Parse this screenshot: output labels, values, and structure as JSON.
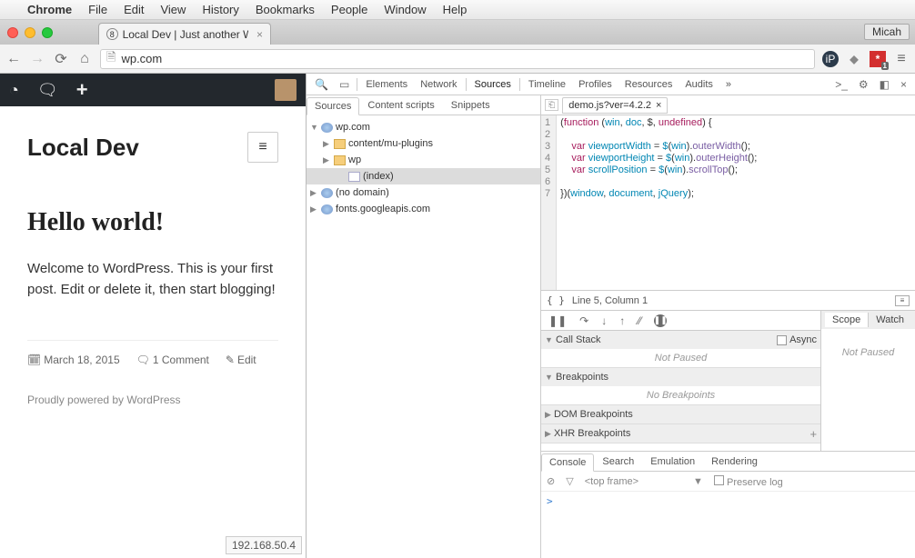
{
  "menubar": {
    "app": "Chrome",
    "items": [
      "File",
      "Edit",
      "View",
      "History",
      "Bookmarks",
      "People",
      "Window",
      "Help"
    ]
  },
  "browser": {
    "tab_title": "Local Dev | Just another W",
    "tab_favicon_text": "8",
    "user_pill": "Micah",
    "url": "wp.com"
  },
  "wordpress": {
    "site_title": "Local Dev",
    "post_title": "Hello world!",
    "post_body": "Welcome to WordPress. This is your first post. Edit or delete it, then start blogging!",
    "post_date": "March 18, 2015",
    "comments": "1 Comment",
    "edit_label": "Edit",
    "footer": "Proudly powered by WordPress",
    "ip": "192.168.50.4"
  },
  "devtools": {
    "main_tabs": [
      "Elements",
      "Network",
      "Sources",
      "Timeline",
      "Profiles",
      "Resources",
      "Audits"
    ],
    "main_overflow": "»",
    "active_main_tab": "Sources",
    "sources_subtabs": [
      "Sources",
      "Content scripts",
      "Snippets"
    ],
    "active_sources_subtab": "Sources",
    "tree": {
      "root": "wp.com",
      "children": [
        {
          "kind": "folder",
          "name": "content/mu-plugins",
          "open": false,
          "depth": 1
        },
        {
          "kind": "folder",
          "name": "wp",
          "open": false,
          "depth": 1
        },
        {
          "kind": "file",
          "name": "(index)",
          "selected": true,
          "depth": 2
        },
        {
          "kind": "domain",
          "name": "(no domain)",
          "depth": 0
        },
        {
          "kind": "domain",
          "name": "fonts.googleapis.com",
          "depth": 0
        }
      ]
    },
    "editor": {
      "open_file": "demo.js?ver=4.2.2",
      "code_lines": [
        "(function (win, doc, $, undefined) {",
        "",
        "    var viewportWidth = $(win).outerWidth();",
        "    var viewportHeight = $(win).outerHeight();",
        "    var scrollPosition = $(win).scrollTop();",
        "",
        "})(window, document, jQuery);"
      ],
      "status": "Line 5, Column 1"
    },
    "debugger": {
      "callstack_label": "Call Stack",
      "async_label": "Async",
      "not_paused": "Not Paused",
      "breakpoints_label": "Breakpoints",
      "no_breakpoints": "No Breakpoints",
      "dom_bp_label": "DOM Breakpoints",
      "xhr_bp_label": "XHR Breakpoints"
    },
    "scope_tabs": [
      "Scope",
      "Watch"
    ],
    "drawer_tabs": [
      "Console",
      "Search",
      "Emulation",
      "Rendering"
    ],
    "active_drawer_tab": "Console",
    "console": {
      "frame_label": "<top frame>",
      "preserve_label": "Preserve log",
      "prompt": ">"
    }
  }
}
